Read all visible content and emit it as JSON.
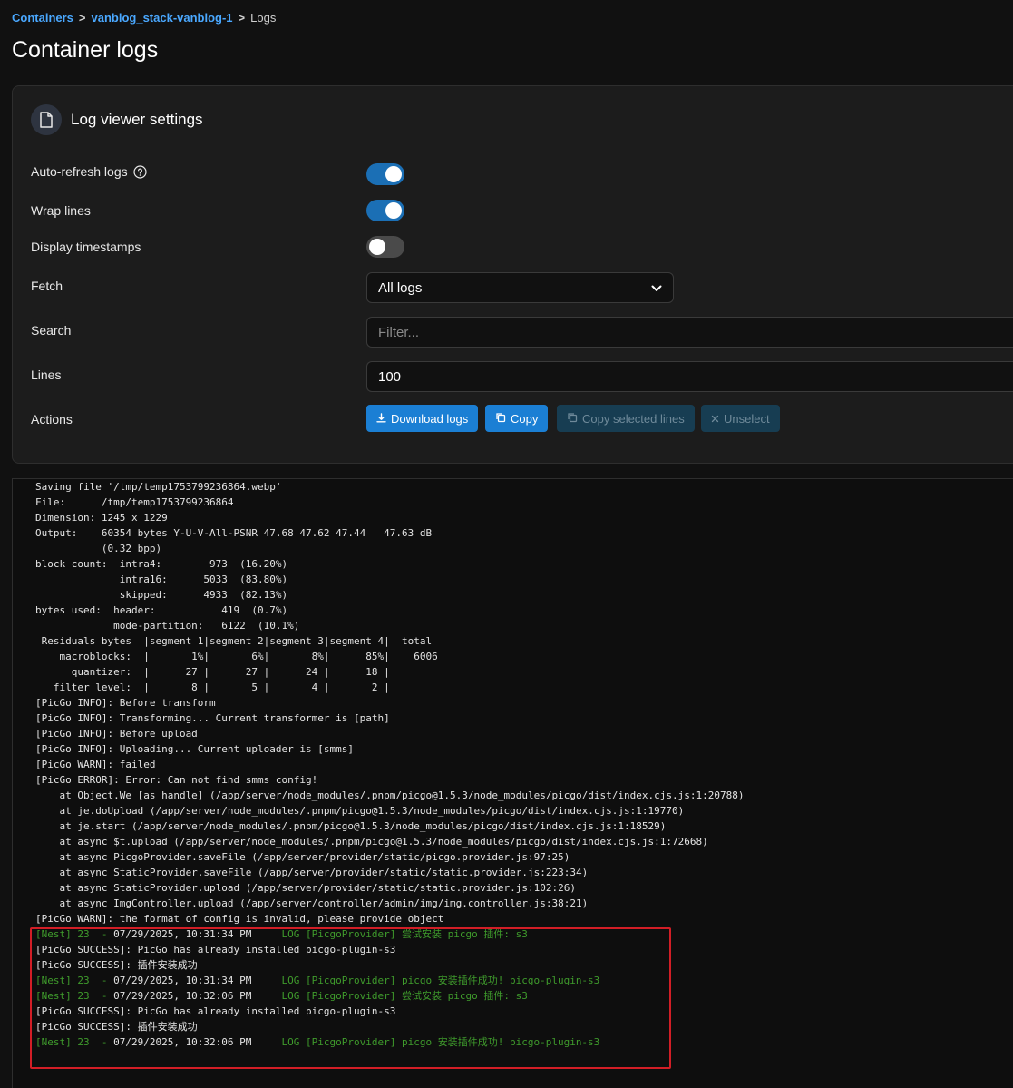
{
  "breadcrumb": {
    "root": "Containers",
    "container": "vanblog_stack-vanblog-1",
    "current": "Logs",
    "separator": ">"
  },
  "page": {
    "title": "Container logs"
  },
  "settings": {
    "title": "Log viewer settings",
    "auto_refresh": {
      "label": "Auto-refresh logs",
      "enabled": true
    },
    "wrap_lines": {
      "label": "Wrap lines",
      "enabled": true
    },
    "display_timestamps": {
      "label": "Display timestamps",
      "enabled": false
    },
    "fetch": {
      "label": "Fetch",
      "value": "All logs"
    },
    "search": {
      "label": "Search",
      "placeholder": "Filter..."
    },
    "lines": {
      "label": "Lines",
      "value": "100"
    },
    "actions": {
      "label": "Actions",
      "download": "Download logs",
      "copy": "Copy",
      "copy_selected": "Copy selected lines",
      "unselect": "Unselect"
    }
  },
  "colors": {
    "accent": "#1b7fd4",
    "toggle_on": "#1b6fb5",
    "nest_green": "#3f9b2c",
    "highlight_red": "#d21e26"
  },
  "log": {
    "lines": [
      {
        "type": "plain",
        "text": "Saving file '/tmp/temp1753799236864.webp'"
      },
      {
        "type": "plain",
        "text": "File:      /tmp/temp1753799236864"
      },
      {
        "type": "plain",
        "text": "Dimension: 1245 x 1229"
      },
      {
        "type": "plain",
        "text": "Output:    60354 bytes Y-U-V-All-PSNR 47.68 47.62 47.44   47.63 dB"
      },
      {
        "type": "plain",
        "text": "           (0.32 bpp)"
      },
      {
        "type": "plain",
        "text": "block count:  intra4:        973  (16.20%)"
      },
      {
        "type": "plain",
        "text": "              intra16:      5033  (83.80%)"
      },
      {
        "type": "plain",
        "text": "              skipped:      4933  (82.13%)"
      },
      {
        "type": "plain",
        "text": "bytes used:  header:           419  (0.7%)"
      },
      {
        "type": "plain",
        "text": "             mode-partition:   6122  (10.1%)"
      },
      {
        "type": "plain",
        "text": " Residuals bytes  |segment 1|segment 2|segment 3|segment 4|  total"
      },
      {
        "type": "plain",
        "text": "    macroblocks:  |       1%|       6%|       8%|      85%|    6006"
      },
      {
        "type": "plain",
        "text": "      quantizer:  |      27 |      27 |      24 |      18 |"
      },
      {
        "type": "plain",
        "text": "   filter level:  |       8 |       5 |       4 |       2 |"
      },
      {
        "type": "plain",
        "text": "[PicGo INFO]: Before transform"
      },
      {
        "type": "plain",
        "text": "[PicGo INFO]: Transforming... Current transformer is [path]"
      },
      {
        "type": "plain",
        "text": "[PicGo INFO]: Before upload"
      },
      {
        "type": "plain",
        "text": "[PicGo INFO]: Uploading... Current uploader is [smms]"
      },
      {
        "type": "plain",
        "text": "[PicGo WARN]: failed"
      },
      {
        "type": "plain",
        "text": "[PicGo ERROR]: Error: Can not find smms config!"
      },
      {
        "type": "plain",
        "text": "    at Object.We [as handle] (/app/server/node_modules/.pnpm/picgo@1.5.3/node_modules/picgo/dist/index.cjs.js:1:20788)"
      },
      {
        "type": "plain",
        "text": "    at je.doUpload (/app/server/node_modules/.pnpm/picgo@1.5.3/node_modules/picgo/dist/index.cjs.js:1:19770)"
      },
      {
        "type": "plain",
        "text": "    at je.start (/app/server/node_modules/.pnpm/picgo@1.5.3/node_modules/picgo/dist/index.cjs.js:1:18529)"
      },
      {
        "type": "plain",
        "text": "    at async $t.upload (/app/server/node_modules/.pnpm/picgo@1.5.3/node_modules/picgo/dist/index.cjs.js:1:72668)"
      },
      {
        "type": "plain",
        "text": "    at async PicgoProvider.saveFile (/app/server/provider/static/picgo.provider.js:97:25)"
      },
      {
        "type": "plain",
        "text": "    at async StaticProvider.saveFile (/app/server/provider/static/static.provider.js:223:34)"
      },
      {
        "type": "plain",
        "text": "    at async StaticProvider.upload (/app/server/provider/static/static.provider.js:102:26)"
      },
      {
        "type": "plain",
        "text": "    at async ImgController.upload (/app/server/controller/admin/img/img.controller.js:38:21)"
      },
      {
        "type": "plain",
        "text": "[PicGo WARN]: the format of config is invalid, please provide object"
      },
      {
        "type": "nest",
        "prefix": "[Nest] 23  - ",
        "ts": "07/29/2025, 10:31:34 PM",
        "rest": "     LOG [PicgoProvider] 尝试安装 picgo 插件: s3"
      },
      {
        "type": "plain",
        "text": "[PicGo SUCCESS]: PicGo has already installed picgo-plugin-s3"
      },
      {
        "type": "plain",
        "text": "[PicGo SUCCESS]: 插件安装成功"
      },
      {
        "type": "nest",
        "prefix": "[Nest] 23  - ",
        "ts": "07/29/2025, 10:31:34 PM",
        "rest": "     LOG [PicgoProvider] picgo 安装插件成功! picgo-plugin-s3"
      },
      {
        "type": "nest",
        "prefix": "[Nest] 23  - ",
        "ts": "07/29/2025, 10:32:06 PM",
        "rest": "     LOG [PicgoProvider] 尝试安装 picgo 插件: s3"
      },
      {
        "type": "plain",
        "text": "[PicGo SUCCESS]: PicGo has already installed picgo-plugin-s3"
      },
      {
        "type": "plain",
        "text": "[PicGo SUCCESS]: 插件安装成功"
      },
      {
        "type": "nest",
        "prefix": "[Nest] 23  - ",
        "ts": "07/29/2025, 10:32:06 PM",
        "rest": "     LOG [PicgoProvider] picgo 安装插件成功! picgo-plugin-s3"
      }
    ]
  }
}
